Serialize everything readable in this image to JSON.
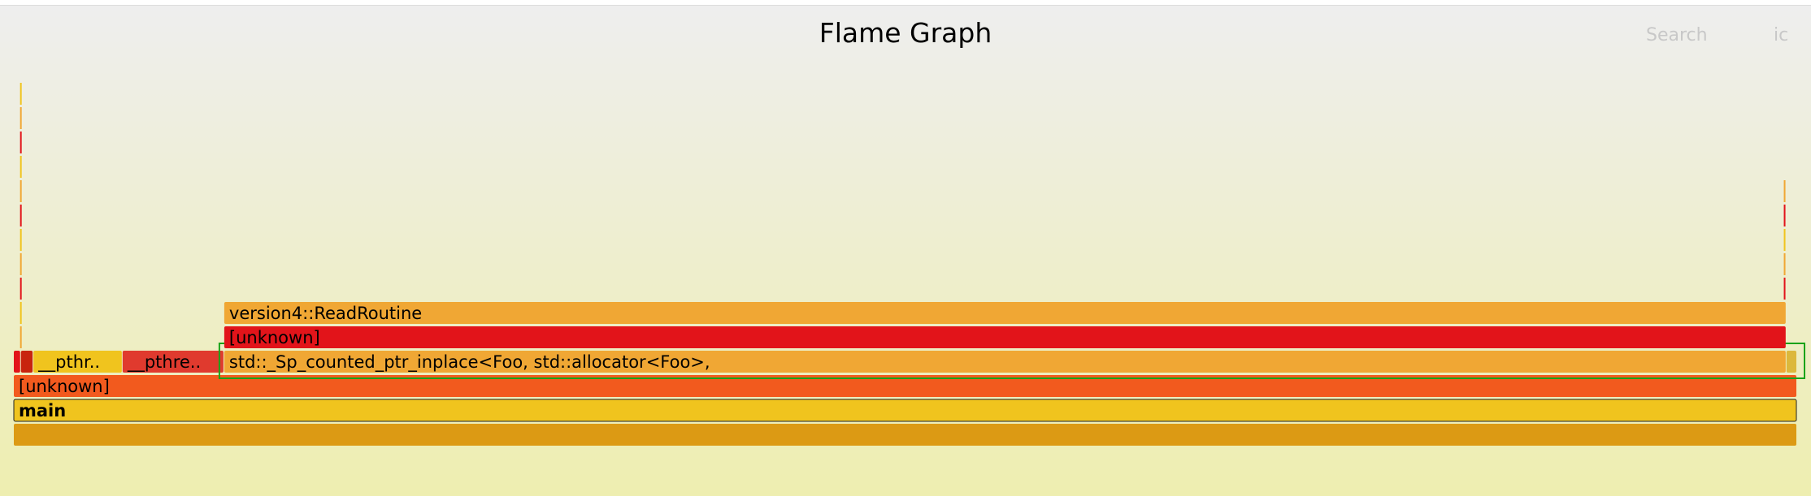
{
  "header": {
    "title": "Flame Graph",
    "search_label": "Search",
    "ic_label": "ic"
  },
  "colors": {
    "orange": "#f0a734",
    "red": "#e2141a",
    "deep_orange": "#f25a1e",
    "yellow": "#f0c41e",
    "amber": "#dc9a14",
    "scarlet": "#e03a2e",
    "highlight_border": "#19a319"
  },
  "chart_data": {
    "type": "flame",
    "title": "Flame Graph",
    "frames": [
      {
        "name": "",
        "depth": 0,
        "start": 0.0,
        "end": 1.0,
        "color": "#dc9a14"
      },
      {
        "name": "main",
        "depth": 1,
        "start": 0.0,
        "end": 1.0,
        "color": "#f0c41e",
        "outlined": true,
        "bold": true
      },
      {
        "name": "[unknown]",
        "depth": 2,
        "start": 0.0,
        "end": 1.0,
        "color": "#f25a1e"
      },
      {
        "name": "",
        "depth": 3,
        "start": 0.0,
        "end": 0.004,
        "color": "#e2141a"
      },
      {
        "name": "",
        "depth": 3,
        "start": 0.004,
        "end": 0.011,
        "color": "#c8240e"
      },
      {
        "name": "__pthr..",
        "depth": 3,
        "start": 0.011,
        "end": 0.061,
        "color": "#f0c41e"
      },
      {
        "name": "__pthre..",
        "depth": 3,
        "start": 0.061,
        "end": 0.118,
        "color": "#e03a2e"
      },
      {
        "name": "std::_Sp_counted_ptr_inplace<Foo, std::allocator<Foo>,",
        "depth": 3,
        "start": 0.118,
        "end": 0.994,
        "color": "#f0a734",
        "highlighted": true
      },
      {
        "name": "",
        "depth": 3,
        "start": 0.994,
        "end": 1.0,
        "color": "#dcb83c"
      },
      {
        "name": "[unknown]",
        "depth": 4,
        "start": 0.118,
        "end": 0.994,
        "color": "#e2141a"
      },
      {
        "name": "version4::ReadRoutine",
        "depth": 5,
        "start": 0.118,
        "end": 0.994,
        "color": "#f0a734"
      }
    ],
    "spikes": [
      {
        "depth_from": 4,
        "depth_to": 14,
        "position": 0.0035,
        "colors": [
          "#e2141a",
          "#f0a734",
          "#f0c41e"
        ]
      },
      {
        "depth_from": 6,
        "depth_to": 10,
        "position": 0.9925,
        "colors": [
          "#e2141a",
          "#f0a734",
          "#f0c41e"
        ]
      }
    ]
  }
}
